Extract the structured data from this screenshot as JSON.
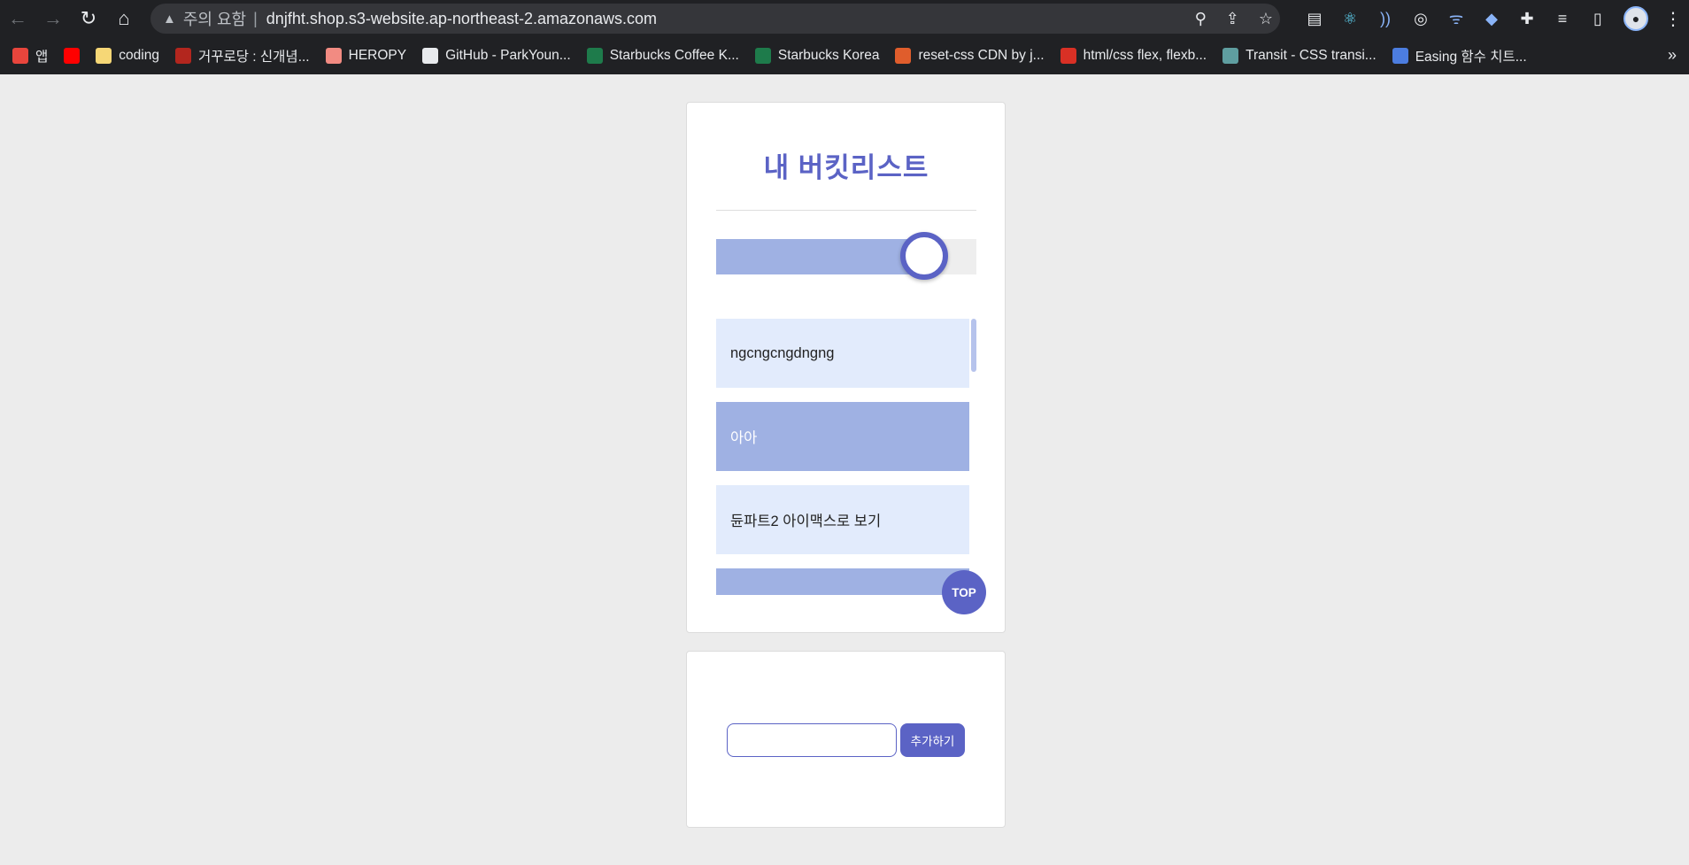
{
  "browser": {
    "omnibox": {
      "warning_text": "주의 요함",
      "separator": "|",
      "url": "dnjfht.shop.s3-website.ap-northeast-2.amazonaws.com"
    },
    "bookmarks": [
      {
        "label": "앱",
        "icon": "apps-grid-icon",
        "color": "#e8453c"
      },
      {
        "label": "",
        "icon": "youtube-icon",
        "color": "#ff0000"
      },
      {
        "label": "coding",
        "icon": "folder-icon",
        "color": "#f6d776"
      },
      {
        "label": "거꾸로당 : 신개념...",
        "icon": "site-icon",
        "color": "#b3261e"
      },
      {
        "label": "HEROPY",
        "icon": "site-icon",
        "color": "#f28b82"
      },
      {
        "label": "GitHub - ParkYoun...",
        "icon": "github-icon",
        "color": "#e8eaed"
      },
      {
        "label": "Starbucks Coffee K...",
        "icon": "starbucks-icon",
        "color": "#1e7b4b"
      },
      {
        "label": "Starbucks Korea",
        "icon": "starbucks-icon",
        "color": "#1e7b4b"
      },
      {
        "label": "reset-css CDN by j...",
        "icon": "site-icon",
        "color": "#e05d2c"
      },
      {
        "label": "html/css flex, flexb...",
        "icon": "site-icon",
        "color": "#d93025"
      },
      {
        "label": "Transit - CSS transi...",
        "icon": "site-icon",
        "color": "#5f9ea0"
      },
      {
        "label": "Easing 함수 치트...",
        "icon": "site-icon",
        "color": "#4c7de0"
      }
    ],
    "bookmarks_more": "»"
  },
  "app": {
    "title": "내 버킷리스트",
    "progress_percent": 80,
    "items": [
      {
        "text": "ngcngcngdngng",
        "completed": false
      },
      {
        "text": "아아",
        "completed": true
      },
      {
        "text": "듄파트2 아이맥스로 보기",
        "completed": false
      },
      {
        "text": "",
        "completed": true
      }
    ],
    "top_button": "TOP",
    "form": {
      "input_value": "",
      "input_placeholder": "",
      "add_button": "추가하기"
    }
  },
  "colors": {
    "accent": "#5b63c5",
    "done_bg": "#9fb1e3",
    "todo_bg": "#e2ebfc",
    "page_bg": "#ececec"
  }
}
